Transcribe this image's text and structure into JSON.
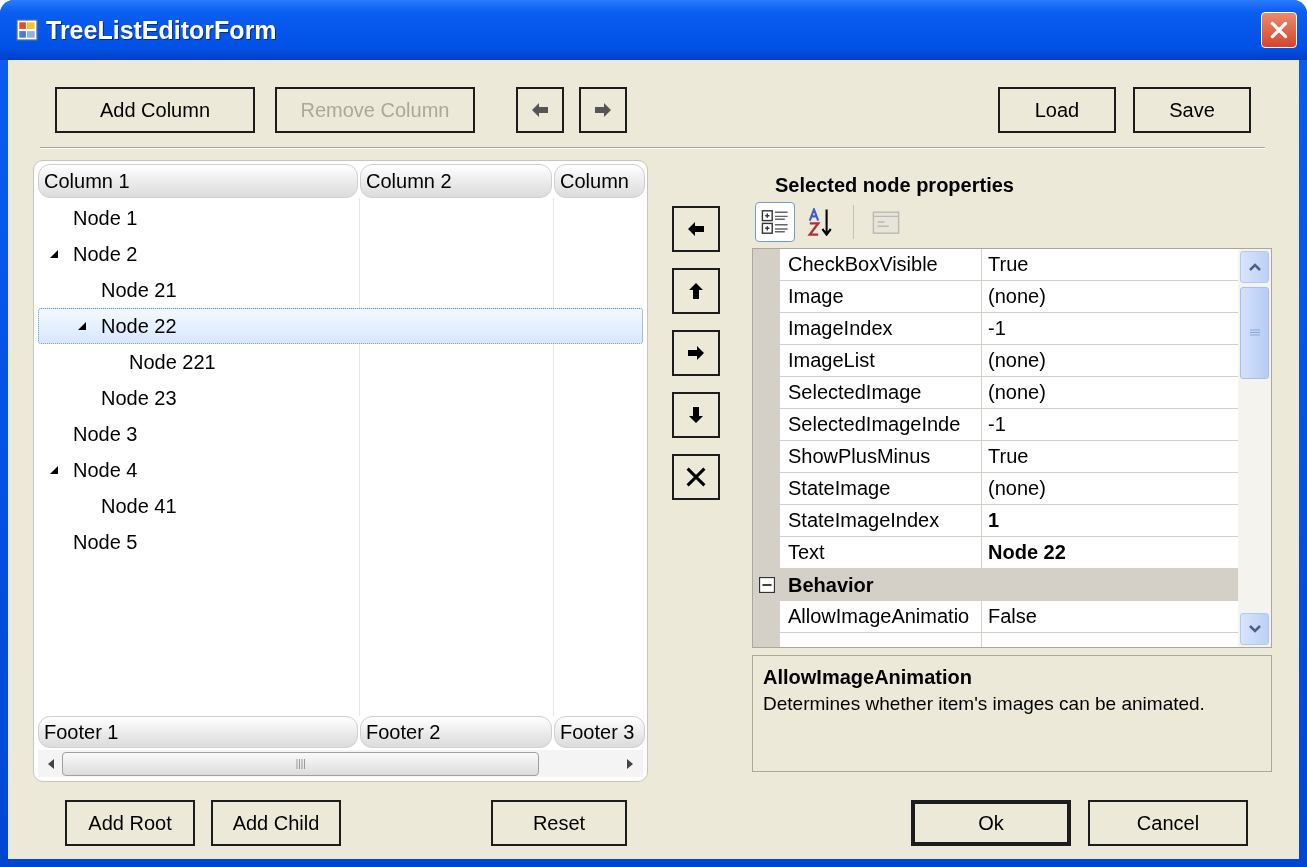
{
  "window": {
    "title": "TreeListEditorForm"
  },
  "toolbar": {
    "left": [
      {
        "kind": "text",
        "label": "Add Column",
        "disabled": false
      },
      {
        "kind": "text",
        "label": "Remove Column",
        "disabled": true
      },
      {
        "kind": "left",
        "disabled": false
      },
      {
        "kind": "right",
        "disabled": false
      }
    ],
    "right": [
      {
        "label": "Load"
      },
      {
        "label": "Save"
      }
    ]
  },
  "tree": {
    "columns": [
      "Column 1",
      "Column 2",
      "Column"
    ],
    "nodes": [
      {
        "label": "Node 1",
        "selected": false
      },
      {
        "label": "Node 2",
        "selected": false,
        "expanded": true,
        "children": [
          {
            "label": "Node 21",
            "selected": false
          },
          {
            "label": "Node 22",
            "selected": true,
            "expanded": true,
            "children": [
              {
                "label": "Node 221",
                "selected": false
              }
            ]
          },
          {
            "label": "Node 23",
            "selected": false
          }
        ]
      },
      {
        "label": "Node 3",
        "selected": false
      },
      {
        "label": "Node 4",
        "selected": false,
        "expanded": true,
        "children": [
          {
            "label": "Node 41",
            "selected": false
          }
        ]
      },
      {
        "label": "Node 5",
        "selected": false
      }
    ],
    "footers": [
      "Footer 1",
      "Footer 2",
      "Footer 3"
    ]
  },
  "move_buttons": [
    {
      "kind": "left"
    },
    {
      "kind": "up"
    },
    {
      "kind": "right"
    },
    {
      "kind": "down"
    },
    {
      "kind": "delete"
    }
  ],
  "properties": {
    "title": "Selected node properties",
    "toolbar": [
      {
        "kind": "categorized",
        "selected": true,
        "disabled": false
      },
      {
        "kind": "alphabetical",
        "selected": false,
        "disabled": false
      },
      {
        "kind": "pages",
        "selected": false,
        "disabled": true
      }
    ],
    "rows": [
      {
        "kind": "property",
        "name": "CheckBoxVisible",
        "value": "True",
        "modified": false
      },
      {
        "kind": "property",
        "name": "Image",
        "value": "(none)",
        "modified": false
      },
      {
        "kind": "property",
        "name": "ImageIndex",
        "value": "-1",
        "modified": false
      },
      {
        "kind": "property",
        "name": "ImageList",
        "value": "(none)",
        "modified": false
      },
      {
        "kind": "property",
        "name": "SelectedImage",
        "value": "(none)",
        "modified": false
      },
      {
        "kind": "property",
        "name": "SelectedImageInde",
        "value": "-1",
        "modified": false
      },
      {
        "kind": "property",
        "name": "ShowPlusMinus",
        "value": "True",
        "modified": false
      },
      {
        "kind": "property",
        "name": "StateImage",
        "value": "(none)",
        "modified": false
      },
      {
        "kind": "property",
        "name": "StateImageIndex",
        "value": "1",
        "modified": true
      },
      {
        "kind": "property",
        "name": "Text",
        "value": "Node 22",
        "modified": true
      },
      {
        "kind": "category",
        "name": "Behavior",
        "expanded": true
      },
      {
        "kind": "property",
        "name": "AllowImageAnimatio",
        "value": "False",
        "modified": false
      }
    ],
    "description": {
      "title": "AllowImageAnimation",
      "text": "Determines whether item's images can be animated."
    }
  },
  "bottom": {
    "left": [
      {
        "label": "Add Root"
      },
      {
        "label": "Add Child"
      }
    ],
    "center": [
      {
        "label": "Reset"
      }
    ],
    "right": [
      {
        "label": "Ok",
        "default": true
      },
      {
        "label": "Cancel",
        "default": false
      }
    ]
  }
}
